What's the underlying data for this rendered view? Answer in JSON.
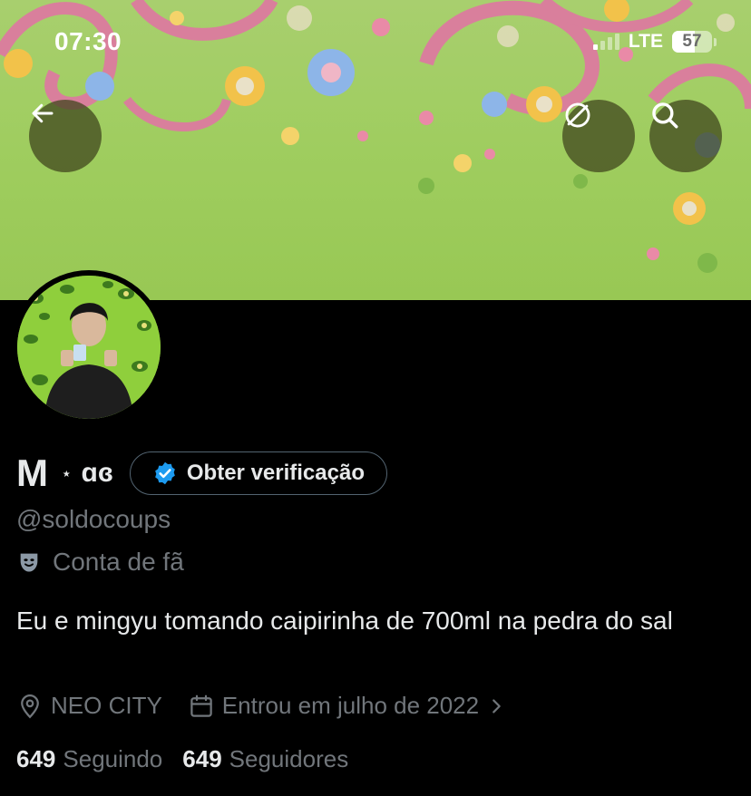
{
  "status_bar": {
    "time": "07:30",
    "network": "LTE",
    "battery": "57",
    "battery_level": 0.57
  },
  "header": {
    "back_icon": "arrow-left-icon",
    "cancel_icon": "cancel-circle-icon",
    "search_icon": "search-icon"
  },
  "profile": {
    "display_name": "M",
    "name_separator": "⋆",
    "name_suffix": "ɑɞ",
    "verify_button_label": "Obter verificação",
    "handle": "@soldocoups",
    "account_type_label": "Conta de fã",
    "bio": "Eu e mingyu tomando caipirinha de 700ml na pedra do sal",
    "location": "NEO CITY",
    "joined": "Entrou em julho de 2022"
  },
  "stats": {
    "following_count": "649",
    "following_label": "Seguindo",
    "followers_count": "649",
    "followers_label": "Seguidores"
  },
  "colors": {
    "background": "#000000",
    "text_primary": "#e7e9ea",
    "text_secondary": "#71767b",
    "verified_blue": "#1d9bf0",
    "banner_green": "#9fcd5f"
  }
}
